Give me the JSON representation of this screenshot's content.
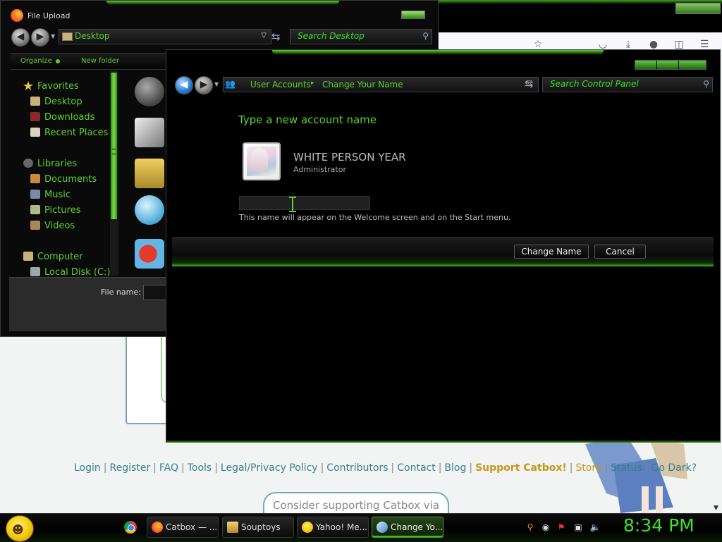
{
  "file_upload": {
    "title": "File Upload",
    "address": "Desktop",
    "search_placeholder": "Search Desktop",
    "toolbar": {
      "organize": "Organize",
      "new_folder": "New folder"
    },
    "nav": [
      {
        "label": "Favorites",
        "icon": "star-icon"
      },
      {
        "label": "Desktop",
        "icon": "desktop-folder-icon"
      },
      {
        "label": "Downloads",
        "icon": "downloads-folder-icon"
      },
      {
        "label": "Recent Places",
        "icon": "recent-places-icon"
      },
      {
        "label": "Libraries",
        "icon": "libraries-icon"
      },
      {
        "label": "Documents",
        "icon": "documents-icon"
      },
      {
        "label": "Music",
        "icon": "music-icon"
      },
      {
        "label": "Pictures",
        "icon": "pictures-icon"
      },
      {
        "label": "Videos",
        "icon": "videos-icon"
      },
      {
        "label": "Computer",
        "icon": "computer-icon"
      },
      {
        "label": "Local Disk (C:)",
        "icon": "local-disk-icon"
      }
    ],
    "filename_label": "File name:"
  },
  "control_panel": {
    "breadcrumb": [
      "User Accounts",
      "Change Your Name"
    ],
    "search_placeholder": "Search Control Panel",
    "heading": "Type a new account name",
    "user_name": "WHITE PERSON YEAR",
    "user_role": "Administrator",
    "name_value": "",
    "hint": "This name will appear on the Welcome screen and on the Start menu.",
    "buttons": {
      "change": "Change Name",
      "cancel": "Cancel"
    }
  },
  "browser_page": {
    "footer_links": [
      "Login",
      "Register",
      "FAQ",
      "Tools",
      "Legal/Privacy Policy",
      "Contributors",
      "Contact",
      "Blog",
      "Support Catbox!",
      "Store",
      "Status",
      "Go Dark?"
    ],
    "support_banner": "Consider supporting Catbox via"
  },
  "taskbar": {
    "tasks": [
      {
        "label": "Catbox — ...",
        "icon": "firefox-icon"
      },
      {
        "label": "Souptoys",
        "icon": "souptoys-icon"
      },
      {
        "label": "Yahoo! Me...",
        "icon": "yahoo-messenger-icon"
      },
      {
        "label": "Change Yo...",
        "icon": "user-accounts-icon"
      }
    ],
    "clock": "8:34 PM"
  },
  "colors": {
    "accent_green": "#5bd22b",
    "window_bg": "#000000",
    "link_teal": "#3a7f8a",
    "support_gold": "#c8961a"
  }
}
